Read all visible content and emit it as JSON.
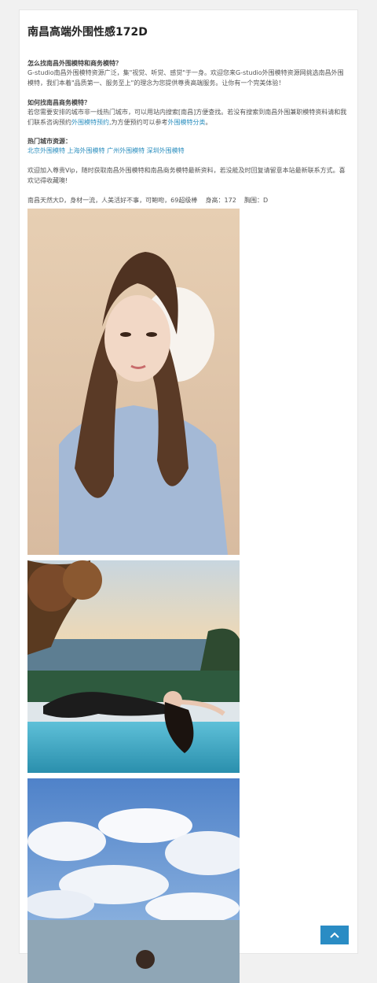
{
  "page": {
    "title": "南昌高端外围性感172D"
  },
  "section1": {
    "heading": "怎么找南昌外围模特和商务模特？",
    "body": "G-studio南昌外围模特资源广泛，集\"视觉、听觉、感觉\"于一身。欢迎您来G-studio外围模特资源网挑选南昌外围模特，我们本着\"品质第一、服务至上\"的理念为您提供尊贵高端服务。让你有一个完美体验！"
  },
  "section2": {
    "heading": "如何找南昌商务模特？",
    "body_before": "若您需要安排的城市非一线热门城市，可以用站内搜索[南昌]方便查找。若没有搜索到南昌外围兼职模特资料请和我们联系咨询预约",
    "link1": "外围模特预约",
    "body_middle": ",为方便预约可以参考",
    "link2": "外围模特分类",
    "body_after": "。"
  },
  "section3": {
    "heading": "热门城市资源：",
    "links": [
      "北京外围模特",
      "上海外围模特",
      "广州外围模特",
      "深圳外围模特"
    ]
  },
  "section4": {
    "body": "欢迎加入尊贵Vip，随时获取南昌外围模特和南昌商务模特最新资料，若没能及时回复请留意本站最新联系方式。喜欢记得收藏噢!"
  },
  "profile": {
    "text": "南昌天然大D，身材一流，人美活好不事，可鲍吻，69超级棒    身高：172    胸围：D"
  },
  "colors": {
    "link": "#2c8fbf",
    "button": "#2a8cc4",
    "background": "#f1f1f1"
  },
  "icons": {
    "back_to_top": "chevron-up-icon"
  }
}
